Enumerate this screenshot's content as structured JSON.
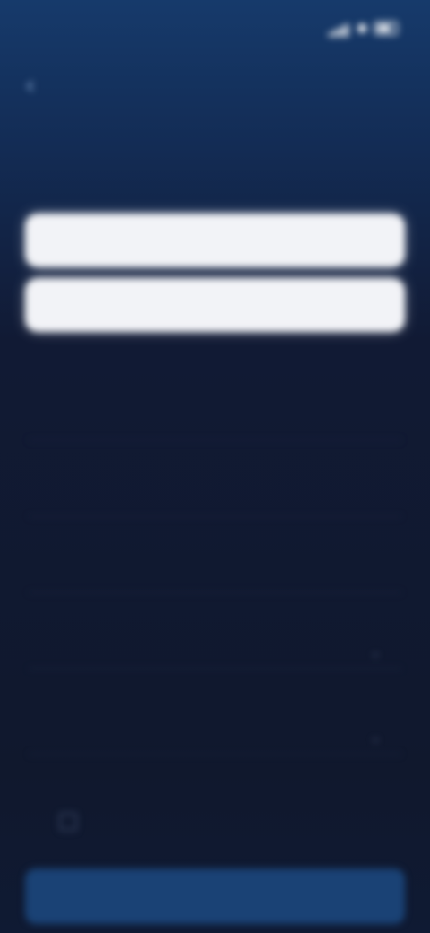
{
  "status_bar": {
    "time": "",
    "icons": [
      "signal-icon",
      "wifi-icon",
      "battery-icon"
    ]
  },
  "nav": {
    "back_icon": "chevron-left-icon",
    "title": ""
  },
  "page_title": "",
  "buttons": {
    "primary_option_1": "",
    "primary_option_2": "",
    "submit": ""
  },
  "section_caption": "",
  "fields": [
    {
      "label": ""
    },
    {
      "label": ""
    },
    {
      "label": ""
    },
    {
      "label": ""
    },
    {
      "label": ""
    }
  ],
  "consent": {
    "text": "",
    "link": ""
  },
  "colors": {
    "background_top": "#163a6b",
    "background_bottom": "#10182d",
    "button_white": "#f2f3f7",
    "button_primary": "#1a4275"
  }
}
